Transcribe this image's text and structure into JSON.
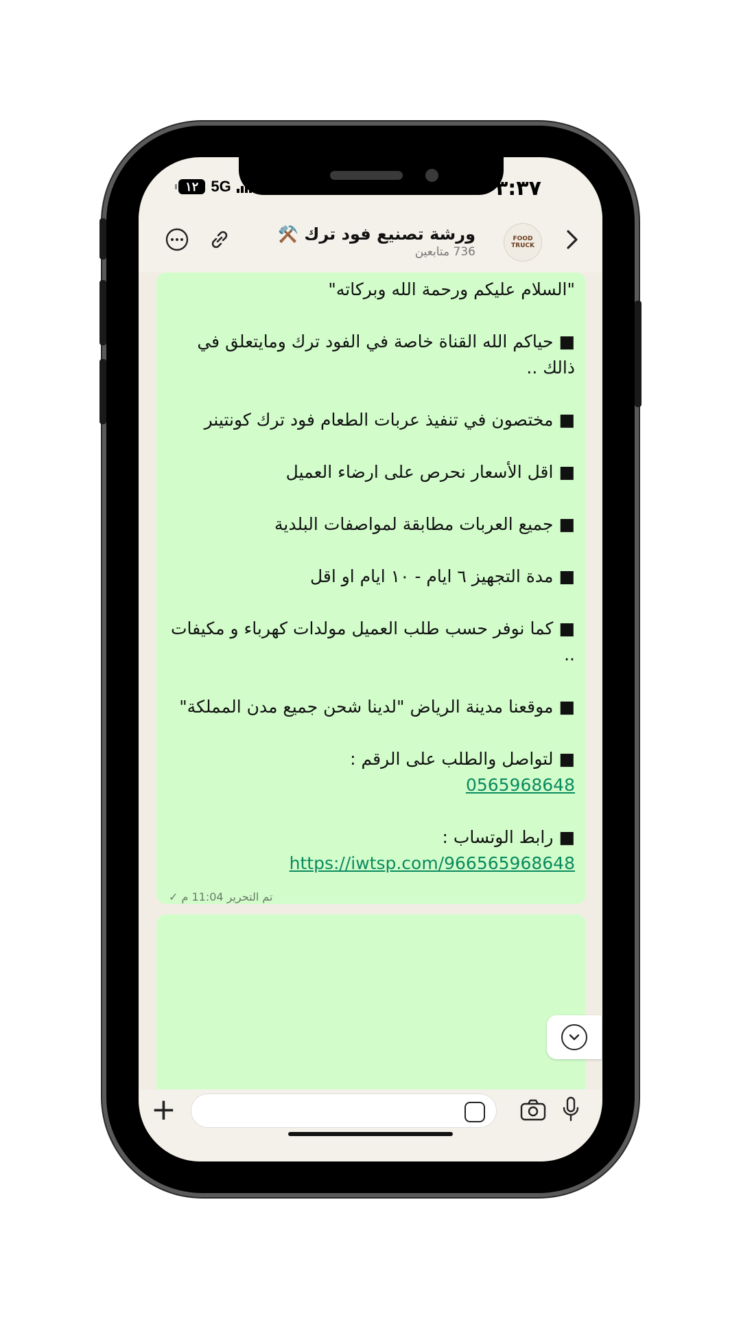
{
  "status_bar": {
    "battery": "١٢",
    "network": "5G",
    "time": "٣:٣٧"
  },
  "header": {
    "back_icon": "chevron-right-icon",
    "title": "ورشة تصنيع فود ترك ⚒️",
    "subtitle": "736 متابعين",
    "avatar_text": "FOOD TRUCK",
    "actions": [
      "link-icon",
      "more-icon"
    ]
  },
  "message": {
    "lines": [
      "\"السلام عليكم ورحمة الله وبركاته\"",
      "■ حياكم الله القناة خاصة في الفود ترك ومايتعلق في ذالك ..",
      "■ مختصون في تنفيذ عربات الطعام فود ترك كونتينر",
      "■ اقل الأسعار نحرص على ارضاء العميل",
      "■ جميع العربات مطابقة لمواصفات البلدية",
      "■ مدة التجهيز ٦ ايام - ١٠ ايام او اقل",
      "■ كما نوفر حسب طلب العميل مولدات كهرباء و مكيفات ..",
      "■ موقعنا مدينة الرياض \"لدينا شحن جميع مدن المملكة\""
    ],
    "contact_label": "■ لتواصل والطلب على الرقم :",
    "phone": "0565968648",
    "whatsapp_label": "■ رابط الوتساب :",
    "whatsapp_link": "https://iwtsp.com/966565968648",
    "meta": "تم التحرير 11:04 م",
    "check": "✓"
  },
  "input_bar": {
    "placeholder": ""
  }
}
